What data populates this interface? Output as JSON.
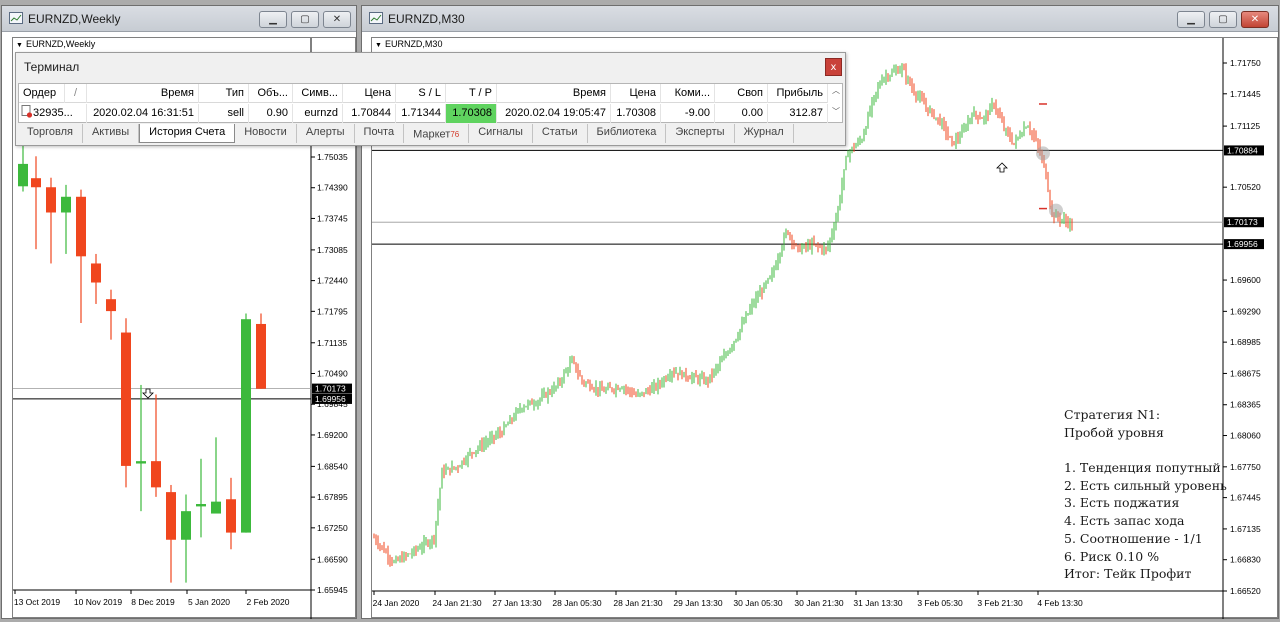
{
  "left_window": {
    "title": "EURNZD,Weekly",
    "symbol_label": "EURNZD,Weekly",
    "price_ticks": [
      "1.75035",
      "1.74390",
      "1.73745",
      "1.73085",
      "1.72440",
      "1.71795",
      "1.71135",
      "1.70490",
      "1.69845",
      "1.69200",
      "1.68540",
      "1.67895",
      "1.67250",
      "1.66590",
      "1.65945"
    ],
    "price_tags": [
      "1.70173",
      "1.69956"
    ],
    "date_ticks": [
      "13 Oct 2019",
      "10 Nov 2019",
      "8 Dec 2019",
      "5 Jan 2020",
      "2 Feb 2020"
    ]
  },
  "right_window": {
    "title": "EURNZD,M30",
    "symbol_label": "EURNZD,M30",
    "price_ticks": [
      "1.71750",
      "1.71445",
      "1.71125",
      "1.70884",
      "1.70520",
      "1.70173",
      "1.69956",
      "1.69600",
      "1.69290",
      "1.68985",
      "1.68675",
      "1.68365",
      "1.68060",
      "1.67750",
      "1.67445",
      "1.67135",
      "1.66830",
      "1.66520"
    ],
    "price_tags": [
      "1.70884",
      "1.70173",
      "1.69956"
    ],
    "date_ticks": [
      "24 Jan 2020",
      "24 Jan 21:30",
      "27 Jan 13:30",
      "28 Jan 05:30",
      "28 Jan 21:30",
      "29 Jan 13:30",
      "30 Jan 05:30",
      "30 Jan 21:30",
      "31 Jan 13:30",
      "3 Feb 05:30",
      "3 Feb 21:30",
      "4 Feb 13:30"
    ]
  },
  "window_buttons": {
    "minimize": "▁",
    "maximize": "▢",
    "close": "✕"
  },
  "terminal": {
    "title": "Терминал",
    "close_label": "x",
    "columns": [
      "Ордер",
      "/",
      "Время",
      "Тип",
      "Объ...",
      "Симв...",
      "Цена",
      "S / L",
      "T / P",
      "Время",
      "Цена",
      "Коми...",
      "Своп",
      "Прибыль"
    ],
    "row": {
      "order": "32935...",
      "open_time": "2020.02.04 16:31:51",
      "type": "sell",
      "volume": "0.90",
      "symbol": "eurnzd",
      "open_price": "1.70844",
      "sl": "1.71344",
      "tp": "1.70308",
      "close_time": "2020.02.04 19:05:47",
      "close_price": "1.70308",
      "commission": "-9.00",
      "swap": "0.00",
      "profit": "312.87"
    },
    "tp_highlight_color": "#5fd35f",
    "tabs": [
      {
        "label": "Торговля",
        "badge": ""
      },
      {
        "label": "Активы",
        "badge": ""
      },
      {
        "label": "История Счета",
        "badge": ""
      },
      {
        "label": "Новости",
        "badge": ""
      },
      {
        "label": "Алерты",
        "badge": ""
      },
      {
        "label": "Почта",
        "badge": ""
      },
      {
        "label": "Маркет",
        "badge": "76"
      },
      {
        "label": "Сигналы",
        "badge": ""
      },
      {
        "label": "Статьи",
        "badge": ""
      },
      {
        "label": "Библиотека",
        "badge": ""
      },
      {
        "label": "Эксперты",
        "badge": ""
      },
      {
        "label": "Журнал",
        "badge": ""
      }
    ],
    "active_tab": "История Счета"
  },
  "strategy_note": {
    "lines": [
      "Стратегия N1:",
      "Пробой уровня",
      "",
      "1. Тенденция попутный",
      "2. Есть сильный уровень",
      "3. Есть поджатия",
      "4. Есть запас хода",
      "5. Соотношение - 1/1",
      "6. Риск 0.10 %",
      "Итог: Тейк Профит"
    ]
  },
  "colors": {
    "bull": "#3cb93c",
    "bear": "#f0461e",
    "level_line": "#000000",
    "tp_cell": "#5fd35f"
  }
}
